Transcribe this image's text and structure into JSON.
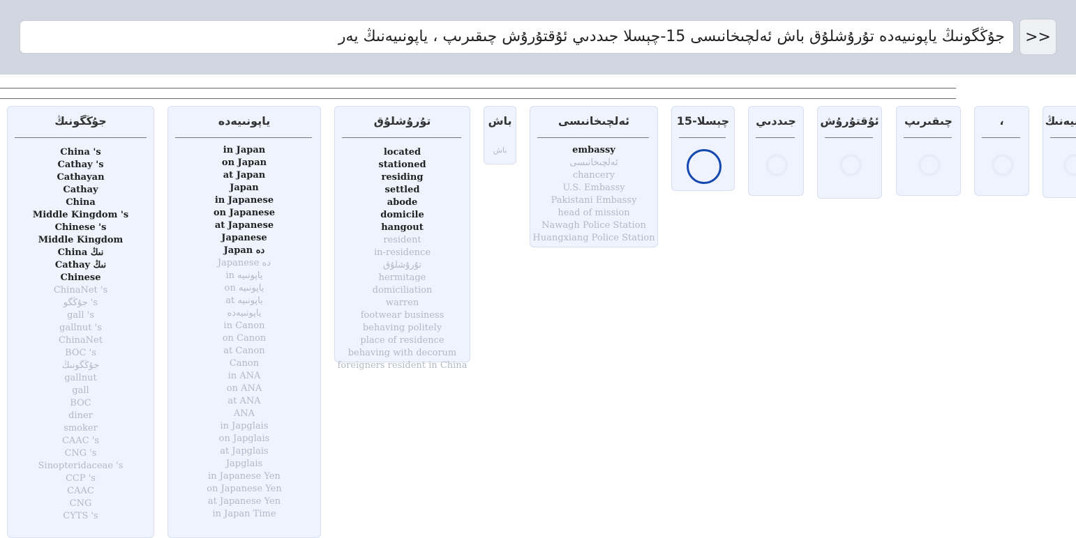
{
  "input": {
    "text": "جۇڭگونىڭ ياپونىيەدە تۇرۇشلۇق باش ئەلچىخانىسى 15-چېسلا جىددىي ئۇقتۇرۇش چىقىرىپ ، ياپونىيەنىڭ يەر"
  },
  "go_button": {
    "label": ">>"
  },
  "columns": [
    {
      "head": "جۇڭگونىڭ",
      "items": [
        {
          "text": "China 's",
          "strong": true
        },
        {
          "text": "Cathay 's",
          "strong": true
        },
        {
          "text": "Cathayan",
          "strong": true
        },
        {
          "text": "Cathay",
          "strong": true
        },
        {
          "text": "China",
          "strong": true
        },
        {
          "text": "Middle Kingdom 's",
          "strong": true
        },
        {
          "text": "Chinese 's",
          "strong": true
        },
        {
          "text": "Middle Kingdom",
          "strong": true
        },
        {
          "text": "China نىڭ",
          "strong": true
        },
        {
          "text": "Cathay نىڭ",
          "strong": true
        },
        {
          "text": "Chinese",
          "strong": true
        },
        {
          "text": "ChinaNet 's",
          "strong": false
        },
        {
          "text": "جۇڭگو 's",
          "strong": false
        },
        {
          "text": "gall 's",
          "strong": false
        },
        {
          "text": "gallnut 's",
          "strong": false
        },
        {
          "text": "ChinaNet",
          "strong": false
        },
        {
          "text": "BOC 's",
          "strong": false
        },
        {
          "text": "جۇڭگونىڭ",
          "strong": false
        },
        {
          "text": "gallnut",
          "strong": false
        },
        {
          "text": "gall",
          "strong": false
        },
        {
          "text": "BOC",
          "strong": false
        },
        {
          "text": "diner",
          "strong": false
        },
        {
          "text": "smoker",
          "strong": false
        },
        {
          "text": "CAAC 's",
          "strong": false
        },
        {
          "text": "CNG 's",
          "strong": false
        },
        {
          "text": "Sinopteridaceae 's",
          "strong": false
        },
        {
          "text": "CCP 's",
          "strong": false
        },
        {
          "text": "CAAC",
          "strong": false
        },
        {
          "text": "CNG",
          "strong": false
        },
        {
          "text": "CYTS 's",
          "strong": false
        }
      ]
    },
    {
      "head": "ياپونىيەدە",
      "items": [
        {
          "text": "in Japan",
          "strong": true
        },
        {
          "text": "on Japan",
          "strong": true
        },
        {
          "text": "at Japan",
          "strong": true
        },
        {
          "text": "Japan",
          "strong": true
        },
        {
          "text": "in Japanese",
          "strong": true
        },
        {
          "text": "on Japanese",
          "strong": true
        },
        {
          "text": "at Japanese",
          "strong": true
        },
        {
          "text": "Japanese",
          "strong": true
        },
        {
          "text": "Japan دە",
          "strong": true
        },
        {
          "text": "Japanese دە",
          "strong": false
        },
        {
          "text": "in ياپونىيە",
          "strong": false
        },
        {
          "text": "on ياپونىيە",
          "strong": false
        },
        {
          "text": "at ياپونىيە",
          "strong": false
        },
        {
          "text": "ياپونىيەدە",
          "strong": false
        },
        {
          "text": "in Canon",
          "strong": false
        },
        {
          "text": "on Canon",
          "strong": false
        },
        {
          "text": "at Canon",
          "strong": false
        },
        {
          "text": "Canon",
          "strong": false
        },
        {
          "text": "in ANA",
          "strong": false
        },
        {
          "text": "on ANA",
          "strong": false
        },
        {
          "text": "at ANA",
          "strong": false
        },
        {
          "text": "ANA",
          "strong": false
        },
        {
          "text": "in Japglais",
          "strong": false
        },
        {
          "text": "on Japglais",
          "strong": false
        },
        {
          "text": "at Japglais",
          "strong": false
        },
        {
          "text": "Japglais",
          "strong": false
        },
        {
          "text": "in Japanese Yen",
          "strong": false
        },
        {
          "text": "on Japanese Yen",
          "strong": false
        },
        {
          "text": "at Japanese Yen",
          "strong": false
        },
        {
          "text": "in Japan Time",
          "strong": false
        }
      ]
    },
    {
      "head": "تۇرۇشلۇق",
      "items": [
        {
          "text": "located",
          "strong": true
        },
        {
          "text": "stationed",
          "strong": true
        },
        {
          "text": "residing",
          "strong": true
        },
        {
          "text": "settled",
          "strong": true
        },
        {
          "text": "abode",
          "strong": true
        },
        {
          "text": "domicile",
          "strong": true
        },
        {
          "text": "hangout",
          "strong": true
        },
        {
          "text": "resident",
          "strong": false
        },
        {
          "text": "in-residence",
          "strong": false
        },
        {
          "text": "تۇرۇشلۇق",
          "strong": false
        },
        {
          "text": "hermitage",
          "strong": false
        },
        {
          "text": "domiciliation",
          "strong": false
        },
        {
          "text": "warren",
          "strong": false
        },
        {
          "text": "footwear business",
          "strong": false
        },
        {
          "text": "behaving politely",
          "strong": false
        },
        {
          "text": "place of residence",
          "strong": false
        },
        {
          "text": "behaving with decorum",
          "strong": false
        },
        {
          "text": "foreigners resident in China",
          "strong": false
        }
      ]
    },
    {
      "head": "باش",
      "items": [
        {
          "text": "باش",
          "strong": false
        }
      ]
    },
    {
      "head": "ئەلچىخانىسى",
      "items": [
        {
          "text": "embassy",
          "strong": true
        },
        {
          "text": "ئەلچىخانىسى",
          "strong": false
        },
        {
          "text": "chancery",
          "strong": false
        },
        {
          "text": "U.S. Embassy",
          "strong": false
        },
        {
          "text": "Pakistani Embassy",
          "strong": false
        },
        {
          "text": "head of mission",
          "strong": false
        },
        {
          "text": "Nawagh Police Station",
          "strong": false
        },
        {
          "text": "Huangxiang Police Station",
          "strong": false
        }
      ]
    },
    {
      "head": "15-چېسلا",
      "items": []
    },
    {
      "head": "جىددىي",
      "items": []
    },
    {
      "head": "ئۇقتۇرۇش",
      "items": []
    },
    {
      "head": "چىقىرىپ",
      "items": []
    },
    {
      "head": "،",
      "items": []
    },
    {
      "head": "ياپونىيەنىڭ",
      "items": []
    }
  ],
  "colors": {
    "topbar": "#d1d6e0",
    "card": "#eef3fd",
    "active_spinner": "#1649b0"
  }
}
